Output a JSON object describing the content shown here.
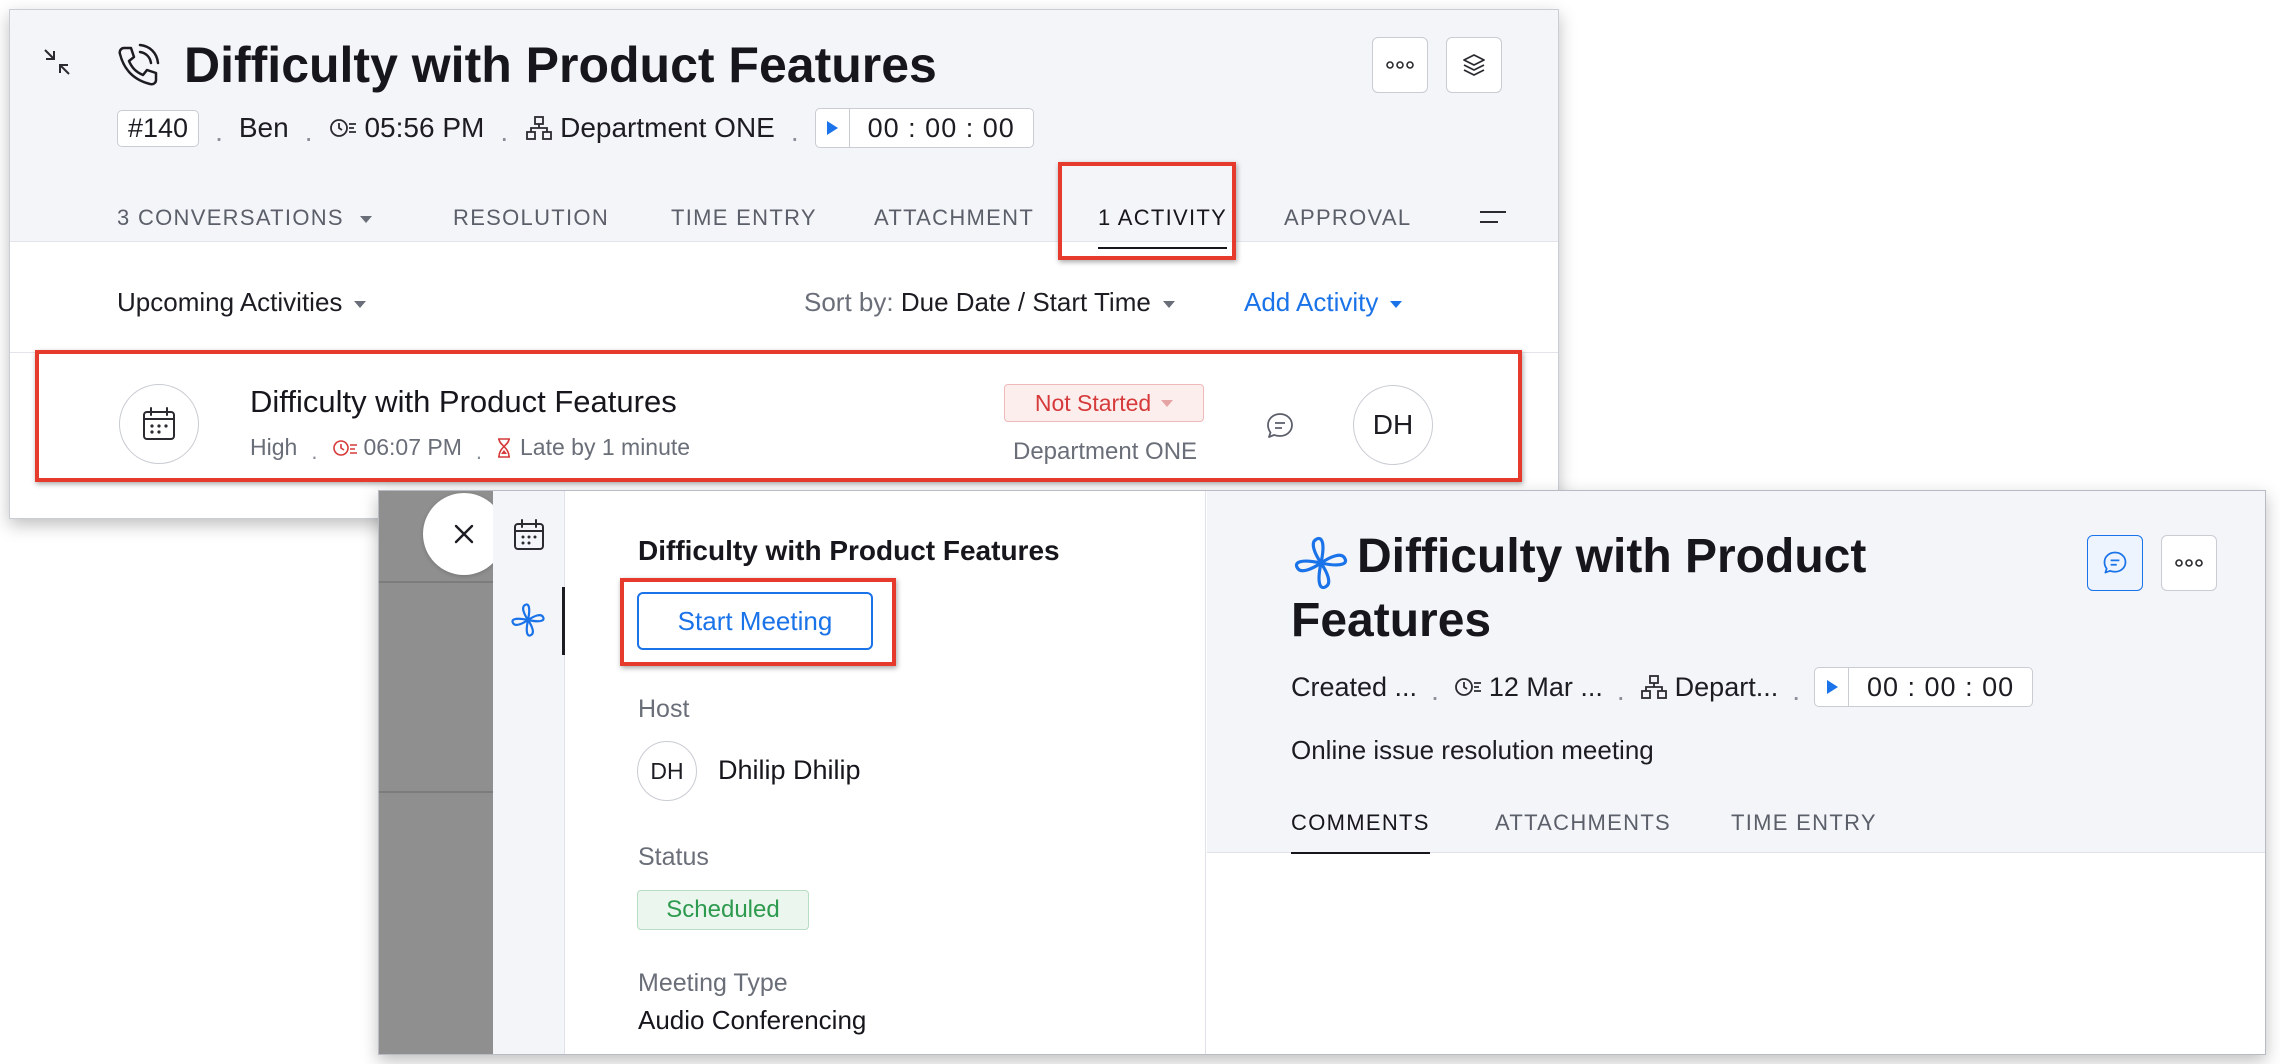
{
  "ticket": {
    "title": "Difficulty with Product Features",
    "id": "#140",
    "contact": "Ben",
    "time": "05:56 PM",
    "department": "Department ONE",
    "timer": "00 : 00 : 00",
    "tabs": [
      {
        "label": "3 CONVERSATIONS"
      },
      {
        "label": "RESOLUTION"
      },
      {
        "label": "TIME ENTRY"
      },
      {
        "label": "ATTACHMENT"
      },
      {
        "label": "1 ACTIVITY"
      },
      {
        "label": "APPROVAL"
      }
    ]
  },
  "activity_toolbar": {
    "filter": "Upcoming Activities",
    "sort_label": "Sort by:",
    "sort_value": "Due Date / Start Time",
    "add_activity": "Add Activity"
  },
  "activity": {
    "title": "Difficulty with Product Features",
    "priority": "High",
    "time": "06:07 PM",
    "late": "Late by 1 minute",
    "status": "Not Started",
    "department": "Department ONE",
    "assignee_initials": "DH"
  },
  "meeting": {
    "title": "Difficulty with Product Features",
    "start_button": "Start Meeting",
    "host_label": "Host",
    "host_initials": "DH",
    "host_name": "Dhilip Dhilip",
    "status_label": "Status",
    "status_value": "Scheduled",
    "type_label": "Meeting Type",
    "type_value": "Audio Conferencing"
  },
  "meeting_info": {
    "title": "Difficulty with Product Features",
    "created": "Created ...",
    "date": "12 Mar ...",
    "department": "Depart...",
    "timer": "00 : 00 : 00",
    "description": "Online issue resolution meeting",
    "tabs": [
      {
        "label": "COMMENTS"
      },
      {
        "label": "ATTACHMENTS"
      },
      {
        "label": "TIME ENTRY"
      }
    ]
  },
  "colors": {
    "accent": "#1a73e8",
    "highlight": "#e53a2c",
    "not_started": "#d63a3a",
    "scheduled": "#2d9a4e"
  }
}
